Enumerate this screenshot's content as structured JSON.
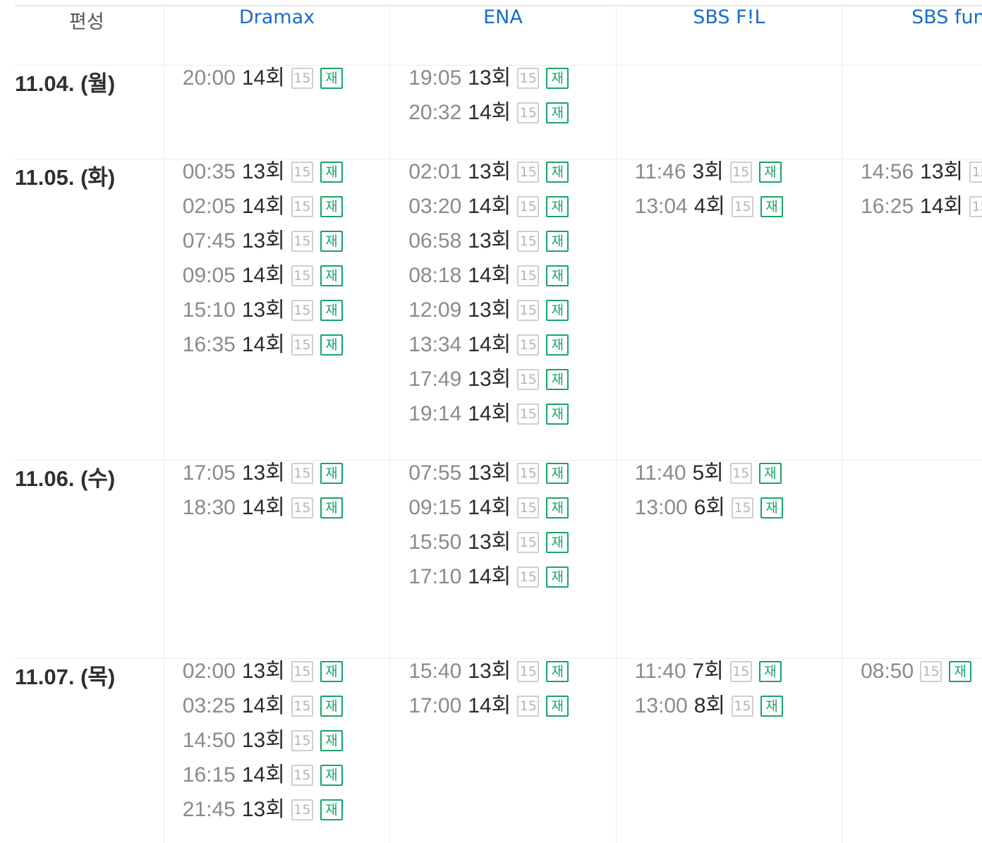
{
  "header": {
    "label": "편성",
    "channels": [
      "Dramax",
      "ENA",
      "SBS F!L",
      "SBS fun"
    ]
  },
  "badges": {
    "age": "15",
    "rerun": "재"
  },
  "colors": {
    "channel_link": "#1a6dc9",
    "rerun_badge": "#17a56a",
    "age_badge": "#b5b5b5"
  },
  "rows": [
    {
      "date": "11.04. (월)",
      "cells": [
        [
          {
            "time": "20:00",
            "ep": "14회"
          }
        ],
        [
          {
            "time": "19:05",
            "ep": "13회"
          },
          {
            "time": "20:32",
            "ep": "14회"
          }
        ],
        [],
        []
      ]
    },
    {
      "date": "11.05. (화)",
      "cells": [
        [
          {
            "time": "00:35",
            "ep": "13회"
          },
          {
            "time": "02:05",
            "ep": "14회"
          },
          {
            "time": "07:45",
            "ep": "13회"
          },
          {
            "time": "09:05",
            "ep": "14회"
          },
          {
            "time": "15:10",
            "ep": "13회"
          },
          {
            "time": "16:35",
            "ep": "14회"
          }
        ],
        [
          {
            "time": "02:01",
            "ep": "13회"
          },
          {
            "time": "03:20",
            "ep": "14회"
          },
          {
            "time": "06:58",
            "ep": "13회"
          },
          {
            "time": "08:18",
            "ep": "14회"
          },
          {
            "time": "12:09",
            "ep": "13회"
          },
          {
            "time": "13:34",
            "ep": "14회"
          },
          {
            "time": "17:49",
            "ep": "13회"
          },
          {
            "time": "19:14",
            "ep": "14회"
          }
        ],
        [
          {
            "time": "11:46",
            "ep": "3회"
          },
          {
            "time": "13:04",
            "ep": "4회"
          }
        ],
        [
          {
            "time": "14:56",
            "ep": "13회"
          },
          {
            "time": "16:25",
            "ep": "14회"
          }
        ]
      ]
    },
    {
      "date": "11.06. (수)",
      "cells": [
        [
          {
            "time": "17:05",
            "ep": "13회"
          },
          {
            "time": "18:30",
            "ep": "14회"
          }
        ],
        [
          {
            "time": "07:55",
            "ep": "13회"
          },
          {
            "time": "09:15",
            "ep": "14회"
          },
          {
            "time": "15:50",
            "ep": "13회"
          },
          {
            "time": "17:10",
            "ep": "14회"
          }
        ],
        [
          {
            "time": "11:40",
            "ep": "5회"
          },
          {
            "time": "13:00",
            "ep": "6회"
          }
        ],
        []
      ]
    },
    {
      "date": "11.07. (목)",
      "cells": [
        [
          {
            "time": "02:00",
            "ep": "13회"
          },
          {
            "time": "03:25",
            "ep": "14회"
          },
          {
            "time": "14:50",
            "ep": "13회"
          },
          {
            "time": "16:15",
            "ep": "14회"
          },
          {
            "time": "21:45",
            "ep": "13회"
          }
        ],
        [
          {
            "time": "15:40",
            "ep": "13회"
          },
          {
            "time": "17:00",
            "ep": "14회"
          }
        ],
        [
          {
            "time": "11:40",
            "ep": "7회"
          },
          {
            "time": "13:00",
            "ep": "8회"
          }
        ],
        [
          {
            "time": "08:50",
            "ep": ""
          }
        ]
      ]
    }
  ]
}
